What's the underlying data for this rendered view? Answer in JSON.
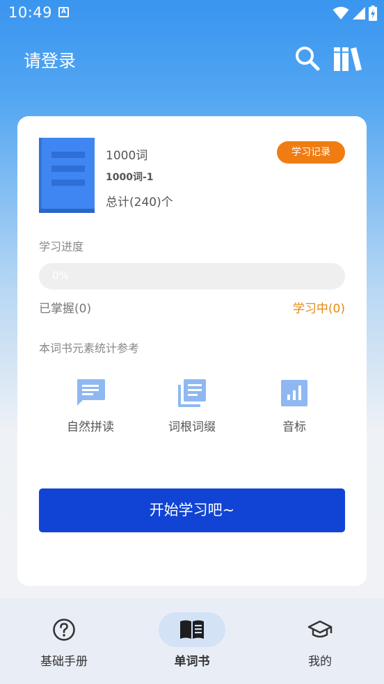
{
  "status_bar": {
    "time": "10:49",
    "notification_icon": "A"
  },
  "header": {
    "title": "请登录",
    "search_icon": "search-icon",
    "library_icon": "bookshelf-icon"
  },
  "book": {
    "name": "1000词",
    "subtitle": "1000词-1",
    "total": "总计(240)个",
    "record_button": "学习记录"
  },
  "progress": {
    "title": "学习进度",
    "percent_text": "0%",
    "value": 0,
    "mastered": "已掌握(0)",
    "learning": "学习中(0)"
  },
  "stats": {
    "title": "本词书元素统计参考",
    "items": [
      {
        "label": "自然拼读",
        "icon": "chat-icon"
      },
      {
        "label": "词根词缀",
        "icon": "library-books-icon"
      },
      {
        "label": "音标",
        "icon": "bar-chart-icon"
      }
    ]
  },
  "start_button": "开始学习吧~",
  "bottom_nav": {
    "items": [
      {
        "label": "基础手册",
        "icon": "help-circle-icon",
        "active": false
      },
      {
        "label": "单词书",
        "icon": "open-book-icon",
        "active": true
      },
      {
        "label": "我的",
        "icon": "graduation-cap-icon",
        "active": false
      }
    ]
  },
  "colors": {
    "primary": "#1144d4",
    "header_blue": "#3a95ef",
    "accent_orange": "#f07c12",
    "icon_blue": "#8fb8f2",
    "book_blue": "#3a84f0"
  }
}
